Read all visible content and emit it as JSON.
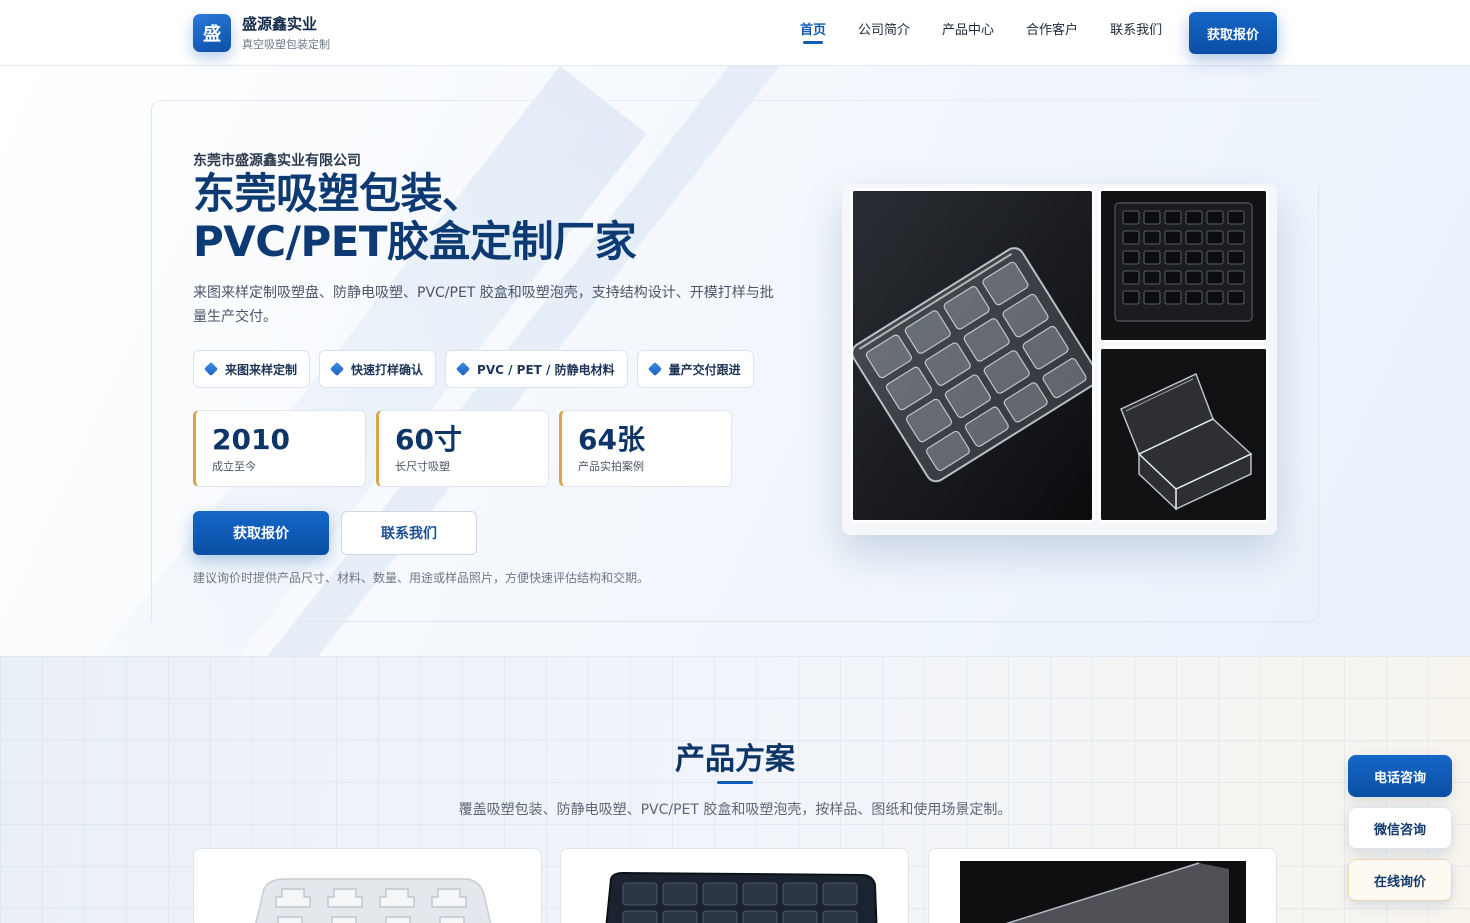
{
  "header": {
    "logo_char": "盛",
    "brand_name": "盛源鑫实业",
    "brand_sub": "真空吸塑包装定制",
    "nav": [
      {
        "label": "首页",
        "active": true
      },
      {
        "label": "公司简介",
        "active": false
      },
      {
        "label": "产品中心",
        "active": false
      },
      {
        "label": "合作客户",
        "active": false
      },
      {
        "label": "联系我们",
        "active": false
      }
    ],
    "quote_button": "获取报价"
  },
  "hero": {
    "company": "东莞市盛源鑫实业有限公司",
    "title_line1": "东莞吸塑包装、",
    "title_line2": "PVC/PET胶盒定制厂家",
    "description": "来图来样定制吸塑盘、防静电吸塑、PVC/PET 胶盒和吸塑泡壳，支持结构设计、开模打样与批量生产交付。",
    "tags": [
      "来图来样定制",
      "快速打样确认",
      "PVC / PET / 防静电材料",
      "量产交付跟进"
    ],
    "stats": [
      {
        "value": "2010",
        "label": "成立至今"
      },
      {
        "value": "60寸",
        "label": "长尺寸吸塑"
      },
      {
        "value": "64张",
        "label": "产品实拍案例"
      }
    ],
    "primary_button": "获取报价",
    "secondary_button": "联系我们",
    "note": "建议询价时提供产品尺寸、材料、数量、用途或样品照片，方便快速评估结构和交期。"
  },
  "products": {
    "title": "产品方案",
    "description": "覆盖吸塑包装、防静电吸塑、PVC/PET 胶盒和吸塑泡壳，按样品、图纸和使用场景定制。"
  },
  "floating": {
    "phone": "电话咨询",
    "wechat": "微信咨询",
    "online": "在线询价"
  },
  "colors": {
    "brand_blue": "#0f5bb5",
    "title_navy": "#0d3a73",
    "stat_accent": "#d9a44a"
  }
}
